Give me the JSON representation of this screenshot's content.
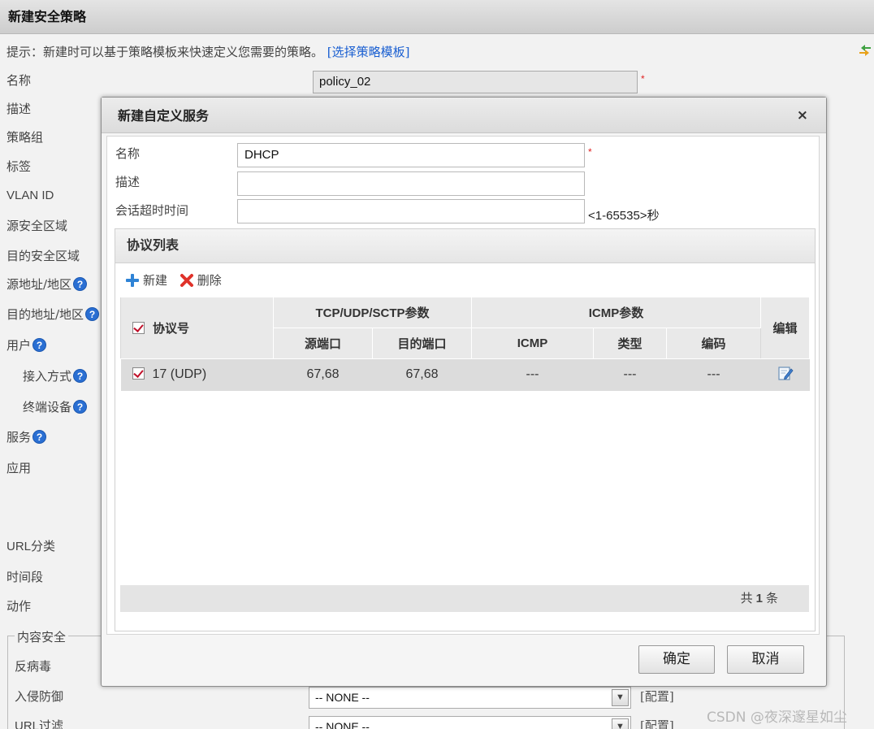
{
  "page": {
    "title": "新建安全策略",
    "hint_prefix": "提示：新建时可以基于策略模板来快速定义您需要的策略。",
    "hint_link": "[选择策略模板]",
    "policy_name_value": "policy_02",
    "required_mark": "*",
    "labels": {
      "name": "名称",
      "description": "描述",
      "policy_group": "策略组",
      "tag": "标签",
      "vlan_id": "VLAN ID",
      "src_zone": "源安全区域",
      "dst_zone": "目的安全区域",
      "src_addr": "源地址/地区",
      "dst_addr": "目的地址/地区",
      "user": "用户",
      "access_mode": "接入方式",
      "terminal": "终端设备",
      "service": "服务",
      "application": "应用",
      "url_category": "URL分类",
      "time_range": "时间段",
      "action": "动作"
    },
    "help_glyph": "?",
    "content_security": {
      "legend": "内容安全",
      "antivirus": "反病毒",
      "ips": "入侵防御",
      "url_filter": "URL过滤",
      "ips_select": "-- NONE --",
      "url_select": "-- NONE --",
      "config_link": "[配置]"
    },
    "watermark": "CSDN @夜深邃星如尘"
  },
  "dialog": {
    "title": "新建自定义服务",
    "close_glyph": "×",
    "fields": {
      "name_label": "名称",
      "name_value": "DHCP",
      "desc_label": "描述",
      "desc_value": "",
      "timeout_label": "会话超时时间",
      "timeout_value": "",
      "timeout_hint": "<1-65535>",
      "timeout_unit": "秒"
    },
    "protocol_list": {
      "heading": "协议列表",
      "new_button": "新建",
      "delete_button": "删除",
      "headers": {
        "protocol": "协议号",
        "tcp_group": "TCP/UDP/SCTP参数",
        "src_port": "源端口",
        "dst_port": "目的端口",
        "icmp_group": "ICMP参数",
        "icmp": "ICMP",
        "type": "类型",
        "code": "编码",
        "edit": "编辑"
      },
      "rows": [
        {
          "protocol": "17 (UDP)",
          "src_port": "67,68",
          "dst_port": "67,68",
          "icmp": "---",
          "type": "---",
          "code": "---"
        }
      ],
      "footer_prefix": "共",
      "footer_count": "1",
      "footer_suffix": "条"
    },
    "ok_button": "确定",
    "cancel_button": "取消"
  },
  "colors": {
    "link": "#1a5fd1",
    "help_badge": "#2a6fd3",
    "required": "#e02020",
    "checkbox_tick": "#c0102a"
  }
}
